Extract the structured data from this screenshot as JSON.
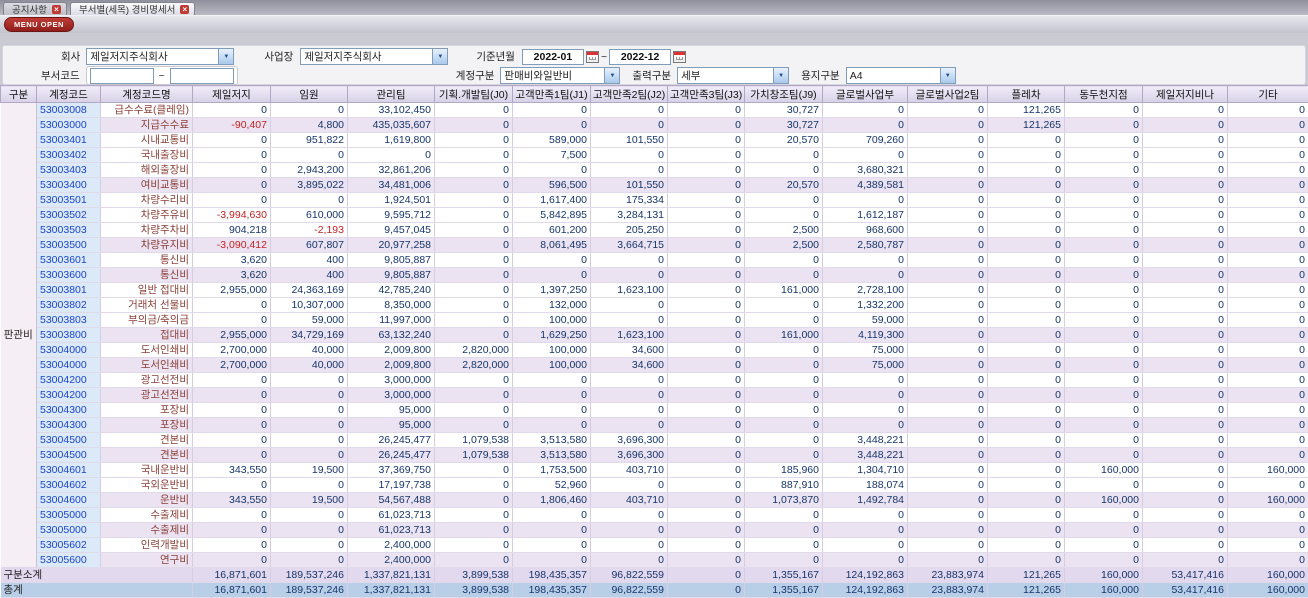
{
  "colors": {
    "code-blue": "#1b46c8",
    "name-maroon": "#8c4038",
    "num-navy": "#16356b",
    "neg-red": "#c42222",
    "total-blue": "#b9cfe8",
    "accent-red": "#a02020"
  },
  "tabs": [
    {
      "label": "공지사항"
    },
    {
      "label": "부서별(세목) 경비명세서"
    }
  ],
  "menu_open_label": "MENU OPEN",
  "filters": {
    "company_label": "회사",
    "company_value": "제일저지주식회사",
    "workplace_label": "사업장",
    "workplace_value": "제일저지주식회사",
    "period_label": "기준년월",
    "period_from": "2022-01",
    "period_to": "2022-12",
    "tilde": "~",
    "dept_code_label": "부서코드",
    "dept_code_from": "",
    "dept_code_to": "",
    "account_type_label": "계정구분",
    "account_type_value": "판매비와일반비",
    "output_type_label": "출력구분",
    "output_type_value": "세부",
    "paper_type_label": "용지구분",
    "paper_type_value": "A4"
  },
  "table": {
    "group_label": "판관비",
    "columns": [
      "구분",
      "계정코드",
      "계정코드명",
      "제일저지",
      "임원",
      "관리팀",
      "기획.개발팀(J0)",
      "고객만족1팀(J1)",
      "고객만족2팀(J2)",
      "고객만족3팀(J3)",
      "가치창조팀(J9)",
      "글로벌사업부",
      "글로벌사업2팀",
      "플레차",
      "동두천지점",
      "제일저지비나",
      "기타"
    ],
    "rows": [
      {
        "code": "53003008",
        "name": "급수수료(클레임)",
        "type": "detail",
        "values": [
          "0",
          "0",
          "33,102,450",
          "0",
          "0",
          "0",
          "0",
          "30,727",
          "0",
          "0",
          "121,265",
          "0",
          "0",
          "0"
        ]
      },
      {
        "code": "53003000",
        "name": "지급수수료",
        "type": "sum",
        "values": [
          "-90,407",
          "4,800",
          "435,035,607",
          "0",
          "0",
          "0",
          "0",
          "30,727",
          "0",
          "0",
          "121,265",
          "0",
          "0",
          "0"
        ]
      },
      {
        "code": "53003401",
        "name": "시내교통비",
        "type": "detail",
        "values": [
          "0",
          "951,822",
          "1,619,800",
          "0",
          "589,000",
          "101,550",
          "0",
          "20,570",
          "709,260",
          "0",
          "0",
          "0",
          "0",
          "0"
        ]
      },
      {
        "code": "53003402",
        "name": "국내출장비",
        "type": "detail",
        "values": [
          "0",
          "0",
          "0",
          "0",
          "7,500",
          "0",
          "0",
          "0",
          "0",
          "0",
          "0",
          "0",
          "0",
          "0"
        ]
      },
      {
        "code": "53003403",
        "name": "해외출장비",
        "type": "detail",
        "values": [
          "0",
          "2,943,200",
          "32,861,206",
          "0",
          "0",
          "0",
          "0",
          "0",
          "3,680,321",
          "0",
          "0",
          "0",
          "0",
          "0"
        ]
      },
      {
        "code": "53003400",
        "name": "여비교통비",
        "type": "sum",
        "values": [
          "0",
          "3,895,022",
          "34,481,006",
          "0",
          "596,500",
          "101,550",
          "0",
          "20,570",
          "4,389,581",
          "0",
          "0",
          "0",
          "0",
          "0"
        ]
      },
      {
        "code": "53003501",
        "name": "차량수리비",
        "type": "detail",
        "values": [
          "0",
          "0",
          "1,924,501",
          "0",
          "1,617,400",
          "175,334",
          "0",
          "0",
          "0",
          "0",
          "0",
          "0",
          "0",
          "0"
        ]
      },
      {
        "code": "53003502",
        "name": "차량주유비",
        "type": "detail",
        "values": [
          "-3,994,630",
          "610,000",
          "9,595,712",
          "0",
          "5,842,895",
          "3,284,131",
          "0",
          "0",
          "1,612,187",
          "0",
          "0",
          "0",
          "0",
          "0"
        ]
      },
      {
        "code": "53003503",
        "name": "차량주차비",
        "type": "detail",
        "values": [
          "904,218",
          "-2,193",
          "9,457,045",
          "0",
          "601,200",
          "205,250",
          "0",
          "2,500",
          "968,600",
          "0",
          "0",
          "0",
          "0",
          "0"
        ]
      },
      {
        "code": "53003500",
        "name": "차량유지비",
        "type": "sum",
        "values": [
          "-3,090,412",
          "607,807",
          "20,977,258",
          "0",
          "8,061,495",
          "3,664,715",
          "0",
          "2,500",
          "2,580,787",
          "0",
          "0",
          "0",
          "0",
          "0"
        ]
      },
      {
        "code": "53003601",
        "name": "통신비",
        "type": "detail",
        "values": [
          "3,620",
          "400",
          "9,805,887",
          "0",
          "0",
          "0",
          "0",
          "0",
          "0",
          "0",
          "0",
          "0",
          "0",
          "0"
        ]
      },
      {
        "code": "53003600",
        "name": "통신비",
        "type": "sum",
        "values": [
          "3,620",
          "400",
          "9,805,887",
          "0",
          "0",
          "0",
          "0",
          "0",
          "0",
          "0",
          "0",
          "0",
          "0",
          "0"
        ]
      },
      {
        "code": "53003801",
        "name": "일반 접대비",
        "type": "detail",
        "values": [
          "2,955,000",
          "24,363,169",
          "42,785,240",
          "0",
          "1,397,250",
          "1,623,100",
          "0",
          "161,000",
          "2,728,100",
          "0",
          "0",
          "0",
          "0",
          "0"
        ]
      },
      {
        "code": "53003802",
        "name": "거래처 선물비",
        "type": "detail",
        "values": [
          "0",
          "10,307,000",
          "8,350,000",
          "0",
          "132,000",
          "0",
          "0",
          "0",
          "1,332,200",
          "0",
          "0",
          "0",
          "0",
          "0"
        ]
      },
      {
        "code": "53003803",
        "name": "부의금/축의금",
        "type": "detail",
        "values": [
          "0",
          "59,000",
          "11,997,000",
          "0",
          "100,000",
          "0",
          "0",
          "0",
          "59,000",
          "0",
          "0",
          "0",
          "0",
          "0"
        ]
      },
      {
        "code": "53003800",
        "name": "접대비",
        "type": "sum",
        "values": [
          "2,955,000",
          "34,729,169",
          "63,132,240",
          "0",
          "1,629,250",
          "1,623,100",
          "0",
          "161,000",
          "4,119,300",
          "0",
          "0",
          "0",
          "0",
          "0"
        ]
      },
      {
        "code": "53004000",
        "name": "도서인쇄비",
        "type": "detail",
        "values": [
          "2,700,000",
          "40,000",
          "2,009,800",
          "2,820,000",
          "100,000",
          "34,600",
          "0",
          "0",
          "75,000",
          "0",
          "0",
          "0",
          "0",
          "0"
        ]
      },
      {
        "code": "53004000",
        "name": "도서인쇄비",
        "type": "sum",
        "values": [
          "2,700,000",
          "40,000",
          "2,009,800",
          "2,820,000",
          "100,000",
          "34,600",
          "0",
          "0",
          "75,000",
          "0",
          "0",
          "0",
          "0",
          "0"
        ]
      },
      {
        "code": "53004200",
        "name": "광고선전비",
        "type": "detail",
        "values": [
          "0",
          "0",
          "3,000,000",
          "0",
          "0",
          "0",
          "0",
          "0",
          "0",
          "0",
          "0",
          "0",
          "0",
          "0"
        ]
      },
      {
        "code": "53004200",
        "name": "광고선전비",
        "type": "sum",
        "values": [
          "0",
          "0",
          "3,000,000",
          "0",
          "0",
          "0",
          "0",
          "0",
          "0",
          "0",
          "0",
          "0",
          "0",
          "0"
        ]
      },
      {
        "code": "53004300",
        "name": "포장비",
        "type": "detail",
        "values": [
          "0",
          "0",
          "95,000",
          "0",
          "0",
          "0",
          "0",
          "0",
          "0",
          "0",
          "0",
          "0",
          "0",
          "0"
        ]
      },
      {
        "code": "53004300",
        "name": "포장비",
        "type": "sum",
        "values": [
          "0",
          "0",
          "95,000",
          "0",
          "0",
          "0",
          "0",
          "0",
          "0",
          "0",
          "0",
          "0",
          "0",
          "0"
        ]
      },
      {
        "code": "53004500",
        "name": "견본비",
        "type": "detail",
        "values": [
          "0",
          "0",
          "26,245,477",
          "1,079,538",
          "3,513,580",
          "3,696,300",
          "0",
          "0",
          "3,448,221",
          "0",
          "0",
          "0",
          "0",
          "0"
        ]
      },
      {
        "code": "53004500",
        "name": "견본비",
        "type": "sum",
        "values": [
          "0",
          "0",
          "26,245,477",
          "1,079,538",
          "3,513,580",
          "3,696,300",
          "0",
          "0",
          "3,448,221",
          "0",
          "0",
          "0",
          "0",
          "0"
        ]
      },
      {
        "code": "53004601",
        "name": "국내운반비",
        "type": "detail",
        "values": [
          "343,550",
          "19,500",
          "37,369,750",
          "0",
          "1,753,500",
          "403,710",
          "0",
          "185,960",
          "1,304,710",
          "0",
          "0",
          "160,000",
          "0",
          "160,000"
        ]
      },
      {
        "code": "53004602",
        "name": "국외운반비",
        "type": "detail",
        "values": [
          "0",
          "0",
          "17,197,738",
          "0",
          "52,960",
          "0",
          "0",
          "887,910",
          "188,074",
          "0",
          "0",
          "0",
          "0",
          "0"
        ]
      },
      {
        "code": "53004600",
        "name": "운반비",
        "type": "sum",
        "values": [
          "343,550",
          "19,500",
          "54,567,488",
          "0",
          "1,806,460",
          "403,710",
          "0",
          "1,073,870",
          "1,492,784",
          "0",
          "0",
          "160,000",
          "0",
          "160,000"
        ]
      },
      {
        "code": "53005000",
        "name": "수출제비",
        "type": "detail",
        "values": [
          "0",
          "0",
          "61,023,713",
          "0",
          "0",
          "0",
          "0",
          "0",
          "0",
          "0",
          "0",
          "0",
          "0",
          "0"
        ]
      },
      {
        "code": "53005000",
        "name": "수출제비",
        "type": "sum",
        "values": [
          "0",
          "0",
          "61,023,713",
          "0",
          "0",
          "0",
          "0",
          "0",
          "0",
          "0",
          "0",
          "0",
          "0",
          "0"
        ]
      },
      {
        "code": "53005602",
        "name": "인력개발비",
        "type": "detail",
        "values": [
          "0",
          "0",
          "2,400,000",
          "0",
          "0",
          "0",
          "0",
          "0",
          "0",
          "0",
          "0",
          "0",
          "0",
          "0"
        ]
      },
      {
        "code": "53005600",
        "name": "연구비",
        "type": "sum",
        "values": [
          "0",
          "0",
          "2,400,000",
          "0",
          "0",
          "0",
          "0",
          "0",
          "0",
          "0",
          "0",
          "0",
          "0",
          "0"
        ]
      }
    ],
    "subtotal": {
      "label": "구분소계",
      "values": [
        "16,871,601",
        "189,537,246",
        "1,337,821,131",
        "3,899,538",
        "198,435,357",
        "96,822,559",
        "0",
        "1,355,167",
        "124,192,863",
        "23,883,974",
        "121,265",
        "160,000",
        "53,417,416",
        "160,000"
      ]
    },
    "total": {
      "label": "총계",
      "values": [
        "16,871,601",
        "189,537,246",
        "1,337,821,131",
        "3,899,538",
        "198,435,357",
        "96,822,559",
        "0",
        "1,355,167",
        "124,192,863",
        "23,883,974",
        "121,265",
        "160,000",
        "53,417,416",
        "160,000"
      ]
    }
  }
}
